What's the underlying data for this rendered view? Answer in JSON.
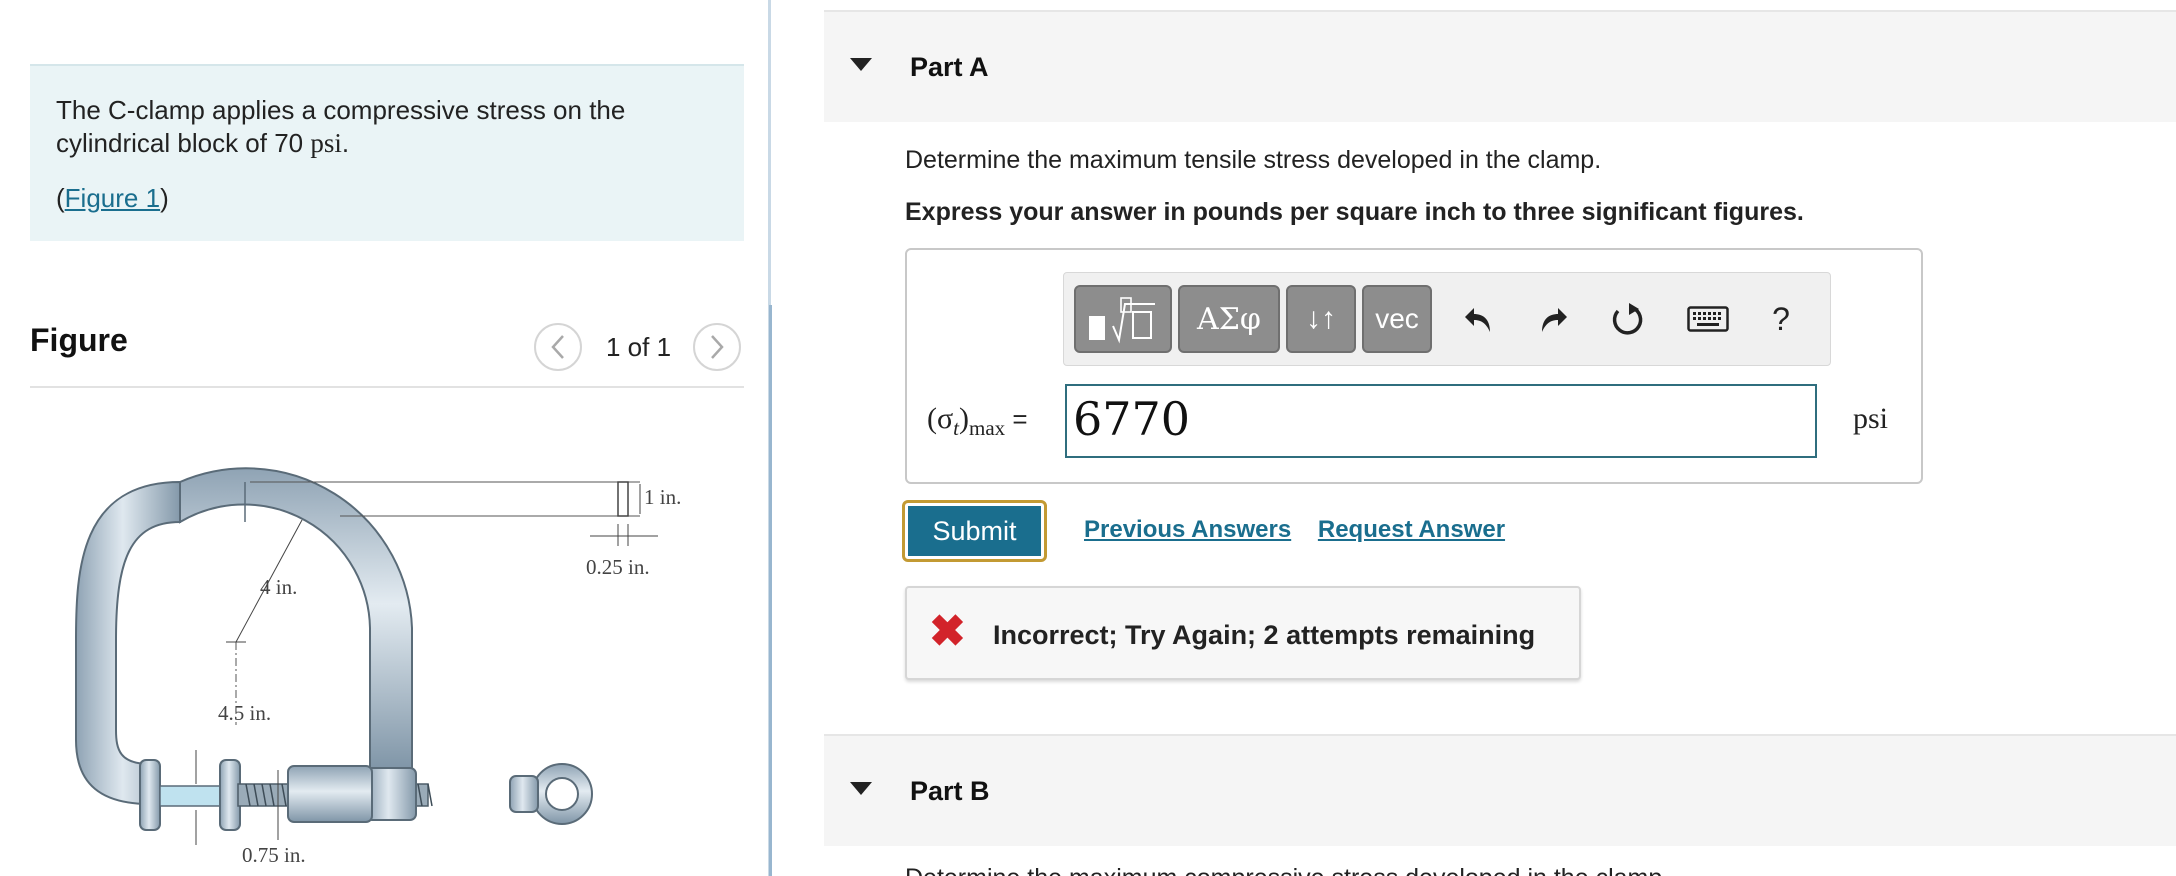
{
  "problem": {
    "text_line1": "The C-clamp applies a compressive stress on the",
    "text_line2_prefix": "cylindrical block of 70 ",
    "text_unit": "psi",
    "text_end": ".",
    "figure_link_open": "(",
    "figure_link": "Figure 1",
    "figure_link_close": ")"
  },
  "figure": {
    "title": "Figure",
    "pager": "1 of 1",
    "prev_icon": "chevron-left-icon",
    "next_icon": "chevron-right-icon",
    "labels": {
      "thickness": "1 in.",
      "width": "0.25 in.",
      "radius": "4 in.",
      "height": "4.5 in.",
      "diameter": "0.75 in."
    }
  },
  "partA": {
    "title": "Part A",
    "question": "Determine the maximum tensile stress developed in the clamp.",
    "instruction": "Express your answer in pounds per square inch to three significant figures.",
    "toolbar": {
      "greek": "ΑΣφ",
      "arrows": "↓↑",
      "vec": "vec",
      "help": "?"
    },
    "answer_label_sigma": "(σ",
    "answer_label_sub_t": "t",
    "answer_label_paren": ")",
    "answer_label_sub_max": "max",
    "answer_label_eq": " =",
    "answer_value": "6770",
    "unit": "psi",
    "submit": "Submit",
    "previous_answers": "Previous Answers",
    "request_answer": "Request Answer",
    "feedback_icon": "x-icon",
    "feedback": "Incorrect; Try Again; 2 attempts remaining"
  },
  "partB": {
    "title": "Part B",
    "question_partial": "Determine the maximum compressive stress developed in the clamp."
  },
  "colors": {
    "link": "#1a6e8e",
    "submit_bg": "#1a6e8e",
    "submit_outline": "#c39a33",
    "error": "#d2232a",
    "problem_bg": "#eaf4f6"
  }
}
